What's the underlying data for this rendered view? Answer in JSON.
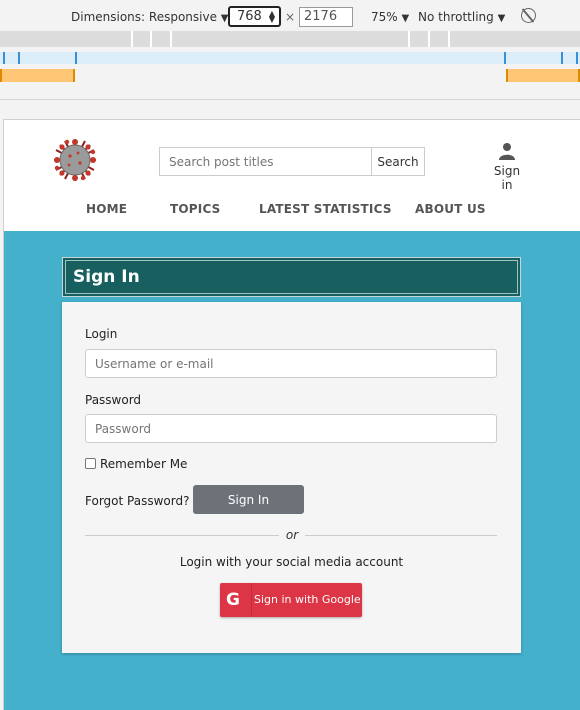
{
  "devtools": {
    "dimensions_label": "Dimensions: Responsive",
    "width_value": "768",
    "times": "×",
    "height_value": "2176",
    "zoom": "75%",
    "throttling": "No throttling",
    "dropdown_glyph": "▼",
    "spin_up": "▲",
    "spin_down": "▼"
  },
  "header": {
    "search_placeholder": "Search post titles",
    "search_button": "Search",
    "signin_label": "Sign in"
  },
  "nav": {
    "items": [
      "HOME",
      "TOPICS",
      "LATEST STATISTICS",
      "ABOUT US"
    ]
  },
  "login": {
    "title": "Sign In",
    "login_label": "Login",
    "login_placeholder": "Username or e-mail",
    "password_label": "Password",
    "password_placeholder": "Password",
    "remember_label": "Remember Me",
    "forgot_label": "Forgot Password?",
    "signin_button": "Sign In",
    "or_text": "or",
    "social_label": "Login with your social media account",
    "google_button": "Sign in with Google",
    "google_icon_letter": "G"
  },
  "colors": {
    "main_bg": "#44b0cc",
    "title_bg": "#18605f",
    "signin_button": "#6c7278",
    "google_button": "#dc3545"
  },
  "icons": [
    "rotate-icon",
    "user-icon",
    "virus-logo-icon",
    "google-icon"
  ]
}
